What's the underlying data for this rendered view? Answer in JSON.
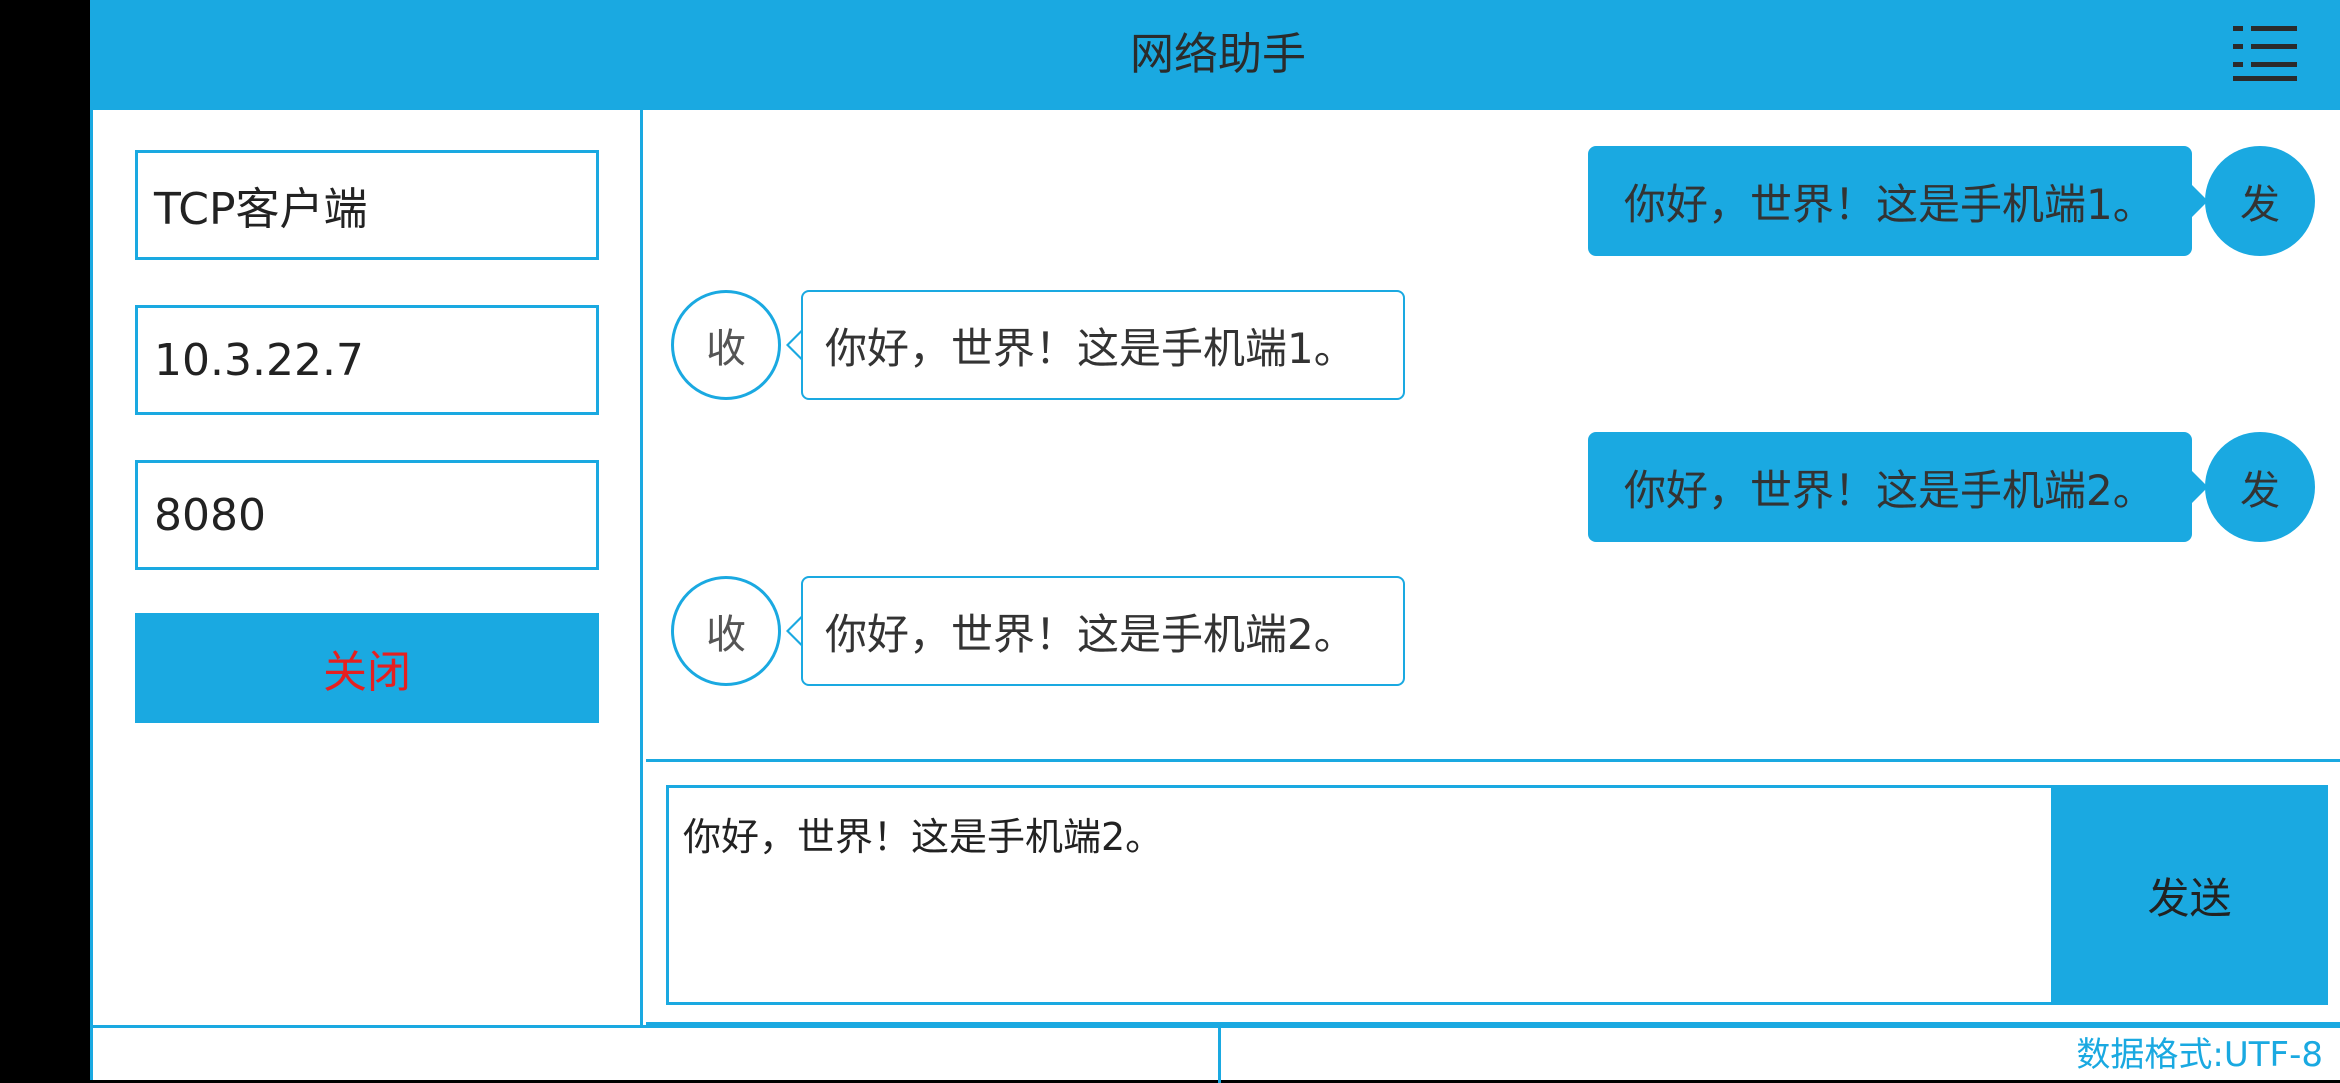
{
  "app": {
    "title": "网络助手"
  },
  "connection": {
    "protocol": "TCP客户端",
    "ip": "10.3.22.7",
    "port": "8080",
    "close_label": "关闭"
  },
  "messages": [
    {
      "direction": "send",
      "avatar": "发",
      "text": "你好，世界！这是手机端1。"
    },
    {
      "direction": "recv",
      "avatar": "收",
      "text": "你好，世界！这是手机端1。"
    },
    {
      "direction": "send",
      "avatar": "发",
      "text": "你好，世界！这是手机端2。"
    },
    {
      "direction": "recv",
      "avatar": "收",
      "text": "你好，世界！这是手机端2。"
    }
  ],
  "composer": {
    "value": "你好，世界！这是手机端2。",
    "send_label": "发送"
  },
  "status": {
    "left_text": "",
    "format": "数据格式:UTF-8"
  },
  "icons": {
    "menu": "menu-list-icon"
  },
  "colors": {
    "accent": "#1aa9e1",
    "close_text": "#e52020"
  }
}
